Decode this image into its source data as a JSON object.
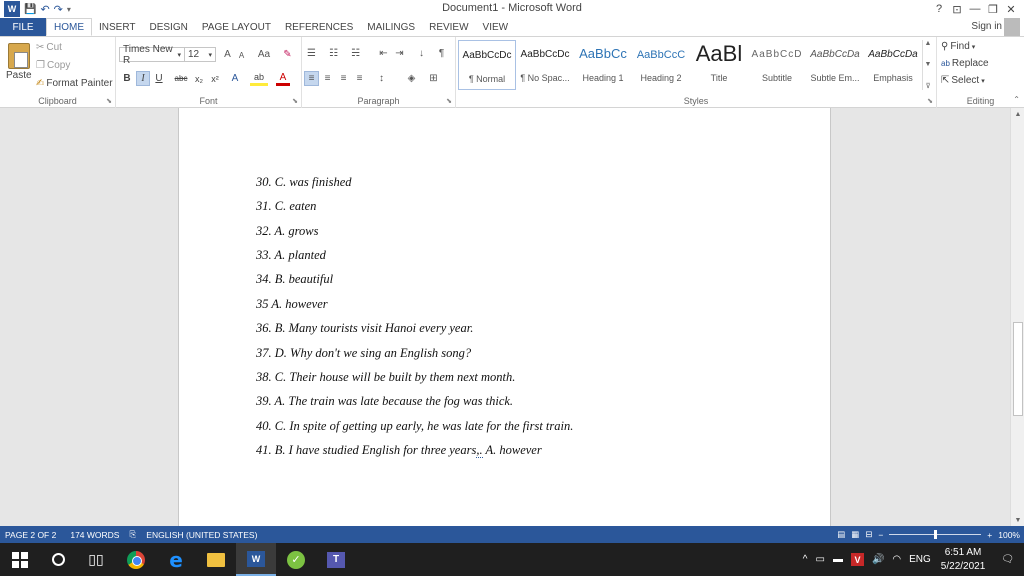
{
  "window": {
    "title": "Document1 - Microsoft Word",
    "help": "?",
    "restore_ribbon": "⊡",
    "minimize": "—",
    "maximize": "❐",
    "close": "✕"
  },
  "qat": {
    "app_icon": "W",
    "save": "💾",
    "undo": "↶",
    "redo": "↷",
    "customize": "▾"
  },
  "tabs": [
    "FILE",
    "HOME",
    "INSERT",
    "DESIGN",
    "PAGE LAYOUT",
    "REFERENCES",
    "MAILINGS",
    "REVIEW",
    "VIEW"
  ],
  "signin": "Sign in",
  "clipboard": {
    "paste": "Paste",
    "cut": "Cut",
    "copy": "Copy",
    "format_painter": "Format Painter",
    "label": "Clipboard"
  },
  "font": {
    "name": "Times New R",
    "size": "12",
    "grow": "A",
    "shrink": "A",
    "case": "Aa",
    "clear": "✎",
    "bold": "B",
    "italic": "I",
    "underline": "U",
    "strike": "abc",
    "sub": "x₂",
    "sup": "x²",
    "effects": "A",
    "highlight": "ab",
    "color": "A",
    "label": "Font"
  },
  "paragraph": {
    "bullets": "☰",
    "numbering": "☷",
    "multilevel": "☵",
    "dec_indent": "⇤",
    "inc_indent": "⇥",
    "sort": "↓",
    "show": "¶",
    "align_left": "≡",
    "center": "≡",
    "align_right": "≡",
    "justify": "≡",
    "spacing": "↕",
    "shading": "◈",
    "borders": "⊞",
    "label": "Paragraph"
  },
  "styles": {
    "label": "Styles",
    "items": [
      {
        "preview": "AaBbCcDc",
        "name": "¶ Normal"
      },
      {
        "preview": "AaBbCcDc",
        "name": "¶ No Spac..."
      },
      {
        "preview": "AaBbCc",
        "name": "Heading 1"
      },
      {
        "preview": "AaBbCcC",
        "name": "Heading 2"
      },
      {
        "preview": "AaBl",
        "name": "Title"
      },
      {
        "preview": "AaBbCcD",
        "name": "Subtitle"
      },
      {
        "preview": "AaBbCcDa",
        "name": "Subtle Em..."
      },
      {
        "preview": "AaBbCcDa",
        "name": "Emphasis"
      }
    ],
    "scroll_up": "▲",
    "scroll_down": "▼",
    "more": "⊽"
  },
  "editing": {
    "find": "Find",
    "replace": "Replace",
    "select": "Select",
    "label": "Editing"
  },
  "document": {
    "lines": [
      "30. C. was finished",
      "31. C. eaten",
      "32. A. grows",
      "33. A. planted",
      "34. B. beautiful",
      "35 A. however",
      "36. B. Many tourists visit Hanoi every year.",
      "37. D. Why don't we sing an English song?",
      "38. C. Their house will be built by them next month.",
      "39. A. The train was late because the fog was thick.",
      "40. C. In spite of getting up early, he was late for the first train."
    ],
    "last_line_a": "41. B. I have studied English for three years",
    "last_line_sq": ",.",
    "last_line_b": " A. however"
  },
  "status": {
    "page": "PAGE 2 OF 2",
    "words": "174 WORDS",
    "language": "ENGLISH (UNITED STATES)",
    "zoom": "100%",
    "zoom_level": 1.0,
    "minus": "−",
    "plus": "+"
  },
  "taskbar": {
    "time": "6:51 AM",
    "date": "5/22/2021",
    "lang": "ENG",
    "tray_up": "^",
    "volume": "🔊",
    "wifi": "◠",
    "notif": "🗨"
  },
  "colors": {
    "accent": "#2b579a",
    "taskbar": "#1f1f1f"
  }
}
